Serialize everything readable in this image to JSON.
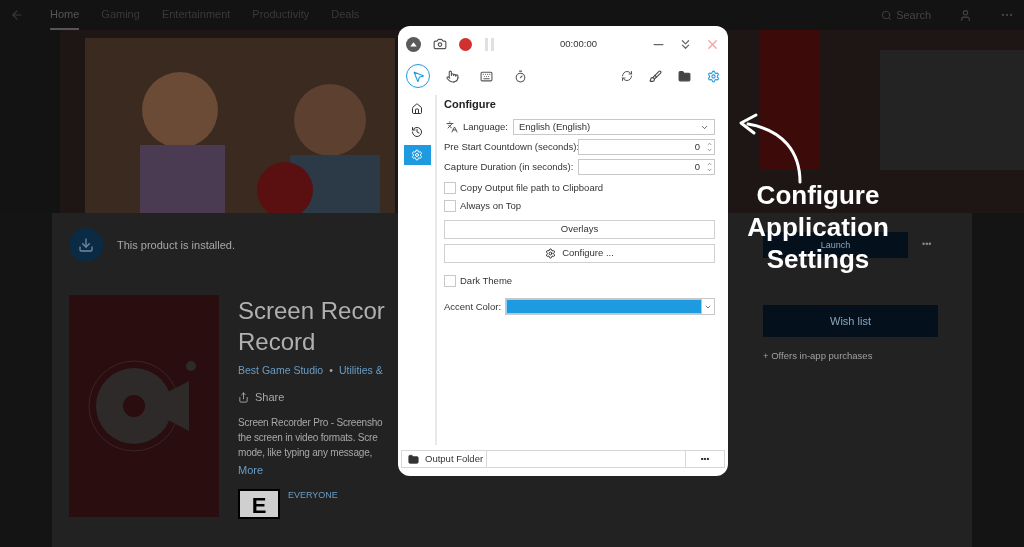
{
  "store": {
    "nav": [
      {
        "label": "Home",
        "selected": true
      },
      {
        "label": "Gaming",
        "selected": false
      },
      {
        "label": "Entertainment",
        "selected": false
      },
      {
        "label": "Productivity",
        "selected": false
      },
      {
        "label": "Deals",
        "selected": false
      }
    ],
    "search": "Search",
    "installed_notice": "This product is installed.",
    "product": {
      "title_lines": [
        "Screen Recor",
        "Record"
      ],
      "publisher": "Best Game Studio",
      "separator": "•",
      "category": "Utilities &",
      "share": "Share",
      "description_lines": [
        "Screen Recorder Pro - Screensho",
        "the screen in video formats. Scre",
        "mode, like typing any message,"
      ],
      "more": "More",
      "rating_badge": "E",
      "rating": "EVERYONE"
    },
    "launch": "Launch",
    "more_button": "•••",
    "wish_list": "Wish list",
    "offers": "+ Offers in-app purchases"
  },
  "app": {
    "timer": "00:00:00",
    "tools": [
      {
        "kind": "cursor",
        "selected": true
      },
      {
        "kind": "hand",
        "selected": false
      },
      {
        "kind": "keyboard",
        "selected": false
      },
      {
        "kind": "timer",
        "selected": false
      }
    ],
    "sidebar": [
      {
        "kind": "home",
        "selected": false
      },
      {
        "kind": "history",
        "selected": false
      },
      {
        "kind": "settings",
        "selected": true
      }
    ],
    "heading": "Configure",
    "language": {
      "label": "Language:",
      "value": "English (English)"
    },
    "numbers": [
      {
        "label": "Pre Start Countdown (seconds):",
        "value": "0"
      },
      {
        "label": "Capture Duration (in seconds):",
        "value": "0"
      }
    ],
    "options": [
      {
        "label": "Copy Output file path to Clipboard",
        "checked": false
      },
      {
        "label": "Always on Top",
        "checked": false
      }
    ],
    "overlays": "Overlays",
    "configure": "Configure ...",
    "dark_theme": {
      "label": "Dark Theme",
      "checked": false
    },
    "accent": {
      "label": "Accent Color:",
      "color": "#1e9be0"
    },
    "output_folder": "Output Folder",
    "output_more": "•••"
  },
  "annotation": [
    "Configure",
    "Application",
    "Settings"
  ]
}
